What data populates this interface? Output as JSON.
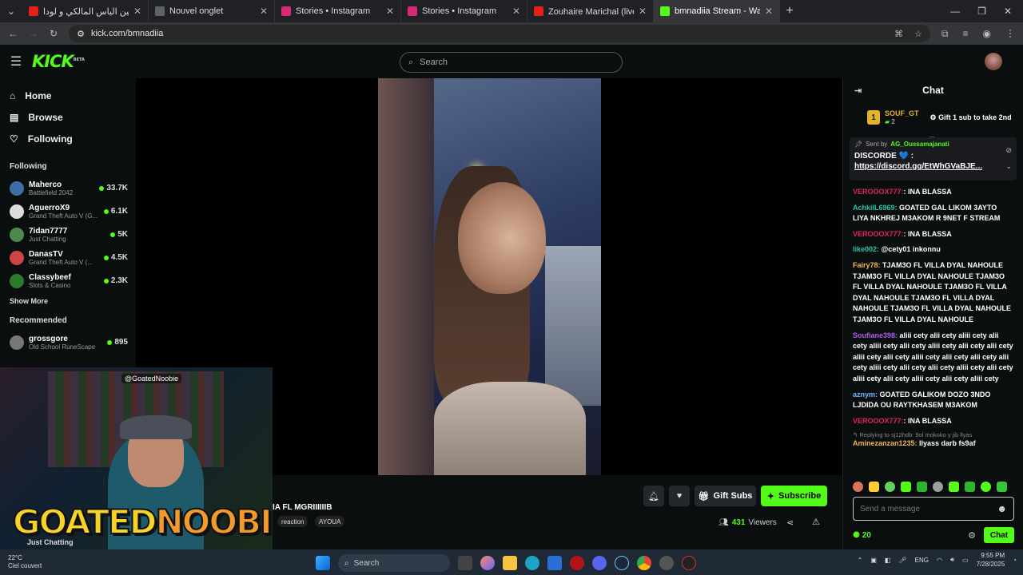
{
  "browser": {
    "tabs": [
      {
        "title": "أش واقع بين الياس المالكي و لودا",
        "favicon_color": "#e62117"
      },
      {
        "title": "Nouvel onglet",
        "favicon_color": "#5f6368"
      },
      {
        "title": "Stories • Instagram",
        "favicon_color": "#d62976"
      },
      {
        "title": "Stories • Instagram",
        "favicon_color": "#d62976"
      },
      {
        "title": "Zouhaire Marichal (live) ماريشال",
        "favicon_color": "#e62117"
      },
      {
        "title": "bmnadiia Stream - Watch Live",
        "favicon_color": "#53fc18"
      }
    ],
    "active_tab": 5,
    "url": "kick.com/bmnadiia",
    "newtab_icon": "+"
  },
  "kick": {
    "logo": "KICK",
    "logo_sup": "BETA",
    "search_placeholder": "Search",
    "nav": [
      {
        "label": "Home",
        "icon": "⌂"
      },
      {
        "label": "Browse",
        "icon": "▤"
      },
      {
        "label": "Following",
        "icon": "♡"
      }
    ],
    "following_title": "Following",
    "following": [
      {
        "name": "Maherco",
        "game": "Battlefield 2042",
        "viewers": "33.7K",
        "color": "#3a6ea5"
      },
      {
        "name": "AguerroX9",
        "game": "Grand Theft Auto V (G...",
        "viewers": "6.1K",
        "color": "#ddd"
      },
      {
        "name": "7idan7777",
        "game": "Just Chatting",
        "viewers": "5K",
        "color": "#4a8a4a"
      },
      {
        "name": "DanasTV",
        "game": "Grand Theft Auto V (...",
        "viewers": "4.5K",
        "color": "#c44"
      },
      {
        "name": "Classybeef",
        "game": "Slots & Casino",
        "viewers": "2.3K",
        "color": "#2a7a2a"
      }
    ],
    "show_more": "Show More",
    "recommended_title": "Recommended",
    "recommended": [
      {
        "name": "grossgore",
        "game": "Old School RuneScape",
        "viewers": "895",
        "color": "#777"
      }
    ],
    "stream": {
      "title": "IA FL MGRIIIIIIB",
      "tags": [
        "reaction",
        "AYOUA"
      ],
      "viewers": "431",
      "viewers_label": "Viewers",
      "gift_label": "Gift Subs",
      "subscribe_label": "Subscribe",
      "category": "Just Chatting"
    },
    "webcam": {
      "handle": "@GoatedNoobie",
      "logo_a": "GOATED",
      "logo_b": "NOOBIE"
    }
  },
  "chat": {
    "title": "Chat",
    "top_gifter": {
      "rank": "1",
      "name": "SOUF_GT",
      "count": "2",
      "cta": "Gift 1 sub to take 2nd"
    },
    "pinned": {
      "sent_by": "Sent by",
      "user": "AG_Oussamajanati",
      "text": "DISCORDE 💙 :",
      "link": "https://discord.gg/EtWhGVaBJE..."
    },
    "messages": [
      {
        "user": "VEROOOX777:",
        "color": "#e0245e",
        "text": ": INA BLASSA"
      },
      {
        "user": "AchkilL6969:",
        "color": "#29c4a9",
        "text": " GOATED GAL LIKOM 3AYTO LIYA NKHREJ M3AKOM R 9NET F STREAM"
      },
      {
        "user": "VEROOOX777:",
        "color": "#e0245e",
        "text": ": INA BLASSA"
      },
      {
        "user": "like002:",
        "color": "#29c4a9",
        "text": " @cety01 inkonnu"
      },
      {
        "user": "Fairy78:",
        "color": "#f2b84b",
        "text": " TJAM3O FL VILLA DYAL NAHOULE TJAM3O FL VILLA DYAL NAHOULE TJAM3O FL VILLA DYAL NAHOULE TJAM3O FL VILLA DYAL NAHOULE TJAM3O FL VILLA DYAL NAHOULE TJAM3O FL VILLA DYAL NAHOULE TJAM3O FL VILLA DYAL NAHOULE"
      },
      {
        "user": "Soufiane398:",
        "color": "#b05cf0",
        "text": " aliii cety alii cety aliii cety alii cety aliii cety alii cety aliii cety alii cety alii cety aliii cety alii cety aliii cety alii cety alii cety alii cety aliii cety alii cety alii cety aliii cety alii cety aliii cety alii cety aliii cety alii cety aliii cety"
      },
      {
        "user": "aznym:",
        "color": "#6cb6ff",
        "text": " GOATED GALIKOM DOZO 3NDO LJDIDA OU RAYTKHASEM M3AKOM"
      },
      {
        "user": "VEROOOX777:",
        "color": "#e0245e",
        "text": ": INA BLASSA"
      }
    ],
    "reply_to": "Replying to sj12hdb: 9ol mokoko y jib llyas",
    "last": {
      "user": "Aminezanzan1235:",
      "color": "#f2b84b",
      "text": " llyass darb fs9af"
    },
    "emote_colors": [
      "#d9735a",
      "#ffcc33",
      "#5ed35e",
      "#53fc18",
      "#2db52d",
      "#9e9e9e",
      "#53fc18",
      "#2db52d",
      "#53fc18",
      "#35c435"
    ],
    "input_placeholder": "Send a message",
    "points": "20",
    "send_label": "Chat"
  },
  "taskbar": {
    "temp": "22°C",
    "weather": "Ciel couvert",
    "search": "Search",
    "lang": "ENG",
    "time": "9:55 PM",
    "date": "7/28/2025"
  }
}
